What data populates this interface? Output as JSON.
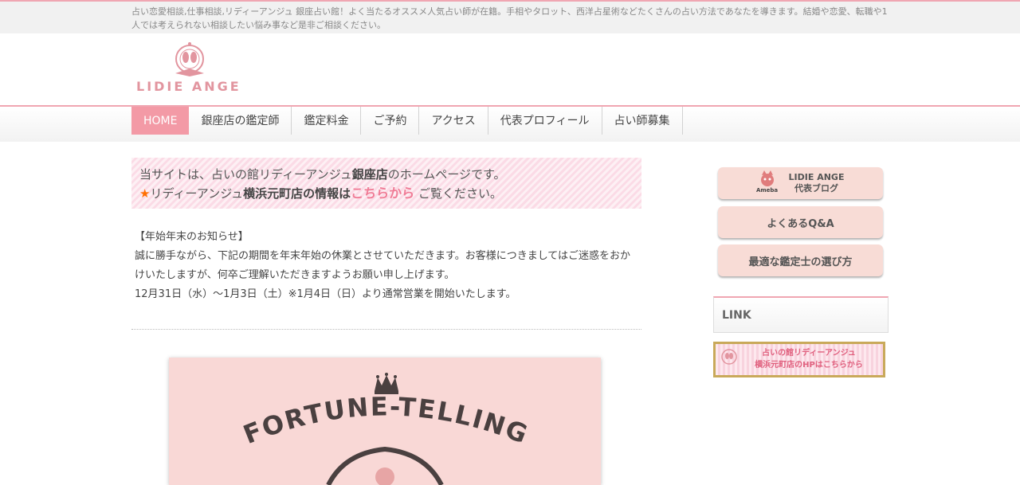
{
  "header": {
    "tagline": "占い恋愛相談,仕事相談,リディーアンジュ 銀座占い館！よく当たるオススメ人気占い師が在籍。手相やタロット、西洋占星術などたくさんの占い方法であなたを導きます。結婚や恋愛、転職や1人では考えられない相談したい悩み事など是非ご相談ください。",
    "logo_text": "LIDIE ANGE"
  },
  "nav": {
    "items": [
      {
        "label": "HOME"
      },
      {
        "label": "銀座店の鑑定師"
      },
      {
        "label": "鑑定料金"
      },
      {
        "label": "ご予約"
      },
      {
        "label": "アクセス"
      },
      {
        "label": "代表プロフィール"
      },
      {
        "label": "占い師募集"
      }
    ]
  },
  "notice": {
    "line1_pre": "当サイトは、占いの館リディーアンジュ",
    "line1_bold": "銀座店",
    "line1_post": "のホームページです。",
    "star": "★",
    "line2_pre": "リディーアンジュ",
    "line2_bold": "横浜元町店の情報は",
    "line2_link": "こちらから",
    "line2_post": "ご覧ください。"
  },
  "news": {
    "title": "【年始年末のお知らせ】",
    "body1": "誠に勝手ながら、下記の期間を年末年始の休業とさせていただきます。お客様につきましてはご迷惑をおかけいたしますが、何卒ご理解いただきますようお願い申し上げます。",
    "body2": "12月31日（水）〜1月3日（土）※1月4日（日）より通常営業を開始いたします。"
  },
  "banner": {
    "heading": "FORTUNE-TELLING"
  },
  "sidebar": {
    "blog_ameba": "Ameba",
    "blog_line1": "LIDIE ANGE",
    "blog_line2": "代表ブログ",
    "faq": "よくあるQ&A",
    "choose": "最適な鑑定士の選び方",
    "link_title": "LINK",
    "yokohama_line1": "占いの館リディーアンジュ",
    "yokohama_line2": "横浜元町店のHPはこちらから"
  },
  "colors": {
    "accent": "#f0a6b2",
    "nav_active": "#f39aa6",
    "link_pink": "#f07c96",
    "star": "#ff7000",
    "button_bg": "#f8dcd6"
  }
}
